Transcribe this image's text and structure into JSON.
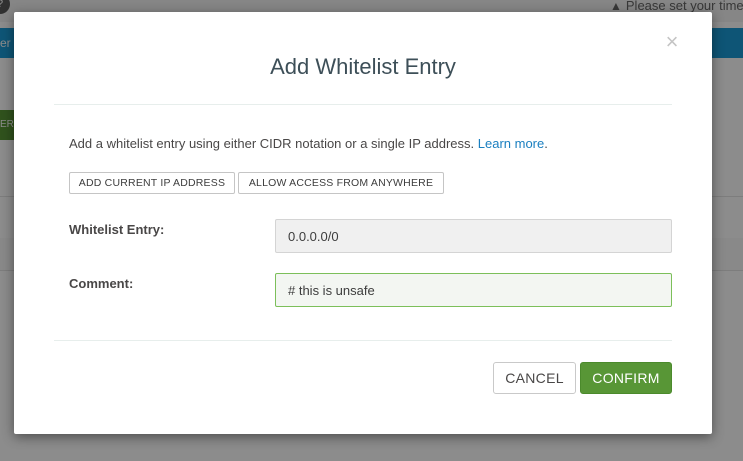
{
  "background": {
    "help_icon_glyph": "?",
    "timezone_warning": "Please set your time",
    "warning_icon": "warning-triangle-icon",
    "bluebar_text": "er",
    "green_button_text": "ER"
  },
  "modal": {
    "title": "Add Whitelist Entry",
    "close_glyph": "×",
    "intro_text": "Add a whitelist entry using either CIDR notation or a single IP address.",
    "learn_more": "Learn more",
    "intro_period": ".",
    "buttons": {
      "add_current_ip": "ADD CURRENT IP ADDRESS",
      "allow_anywhere": "ALLOW ACCESS FROM ANYWHERE",
      "cancel": "CANCEL",
      "confirm": "CONFIRM"
    },
    "fields": {
      "entry_label": "Whitelist Entry:",
      "entry_value": "0.0.0.0/0",
      "comment_label": "Comment:",
      "comment_value": "# this is unsafe"
    }
  },
  "colors": {
    "accent_green": "#589636",
    "link_blue": "#1a7fc0",
    "focus_border": "#7cbf5a"
  }
}
